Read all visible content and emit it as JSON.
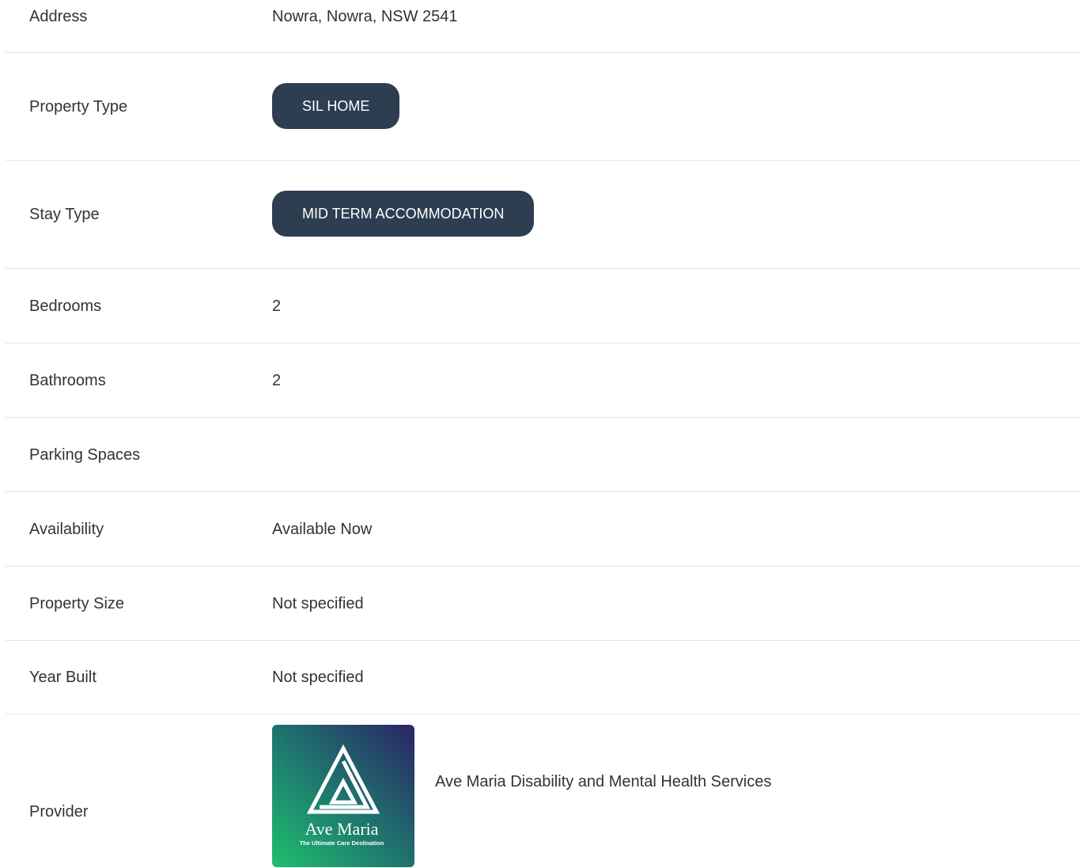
{
  "details": {
    "address": {
      "label": "Address",
      "value": "Nowra, Nowra, NSW 2541"
    },
    "property_type": {
      "label": "Property Type",
      "value": "SIL HOME"
    },
    "stay_type": {
      "label": "Stay Type",
      "value": "MID TERM ACCOMMODATION"
    },
    "bedrooms": {
      "label": "Bedrooms",
      "value": "2"
    },
    "bathrooms": {
      "label": "Bathrooms",
      "value": "2"
    },
    "parking": {
      "label": "Parking Spaces",
      "value": ""
    },
    "availability": {
      "label": "Availability",
      "value": "Available Now"
    },
    "property_size": {
      "label": "Property Size",
      "value": "Not specified"
    },
    "year_built": {
      "label": "Year Built",
      "value": "Not specified"
    },
    "provider": {
      "label": "Provider",
      "name": "Ave Maria Disability and Mental Health Services",
      "logo_text": "Ave Maria",
      "logo_tagline": "The Ultimate Care Destination",
      "logo_icon": "triangle-logo-icon"
    }
  },
  "colors": {
    "pill_bg": "#2c3e50",
    "divider": "#e2e4e7",
    "text": "#333333"
  }
}
